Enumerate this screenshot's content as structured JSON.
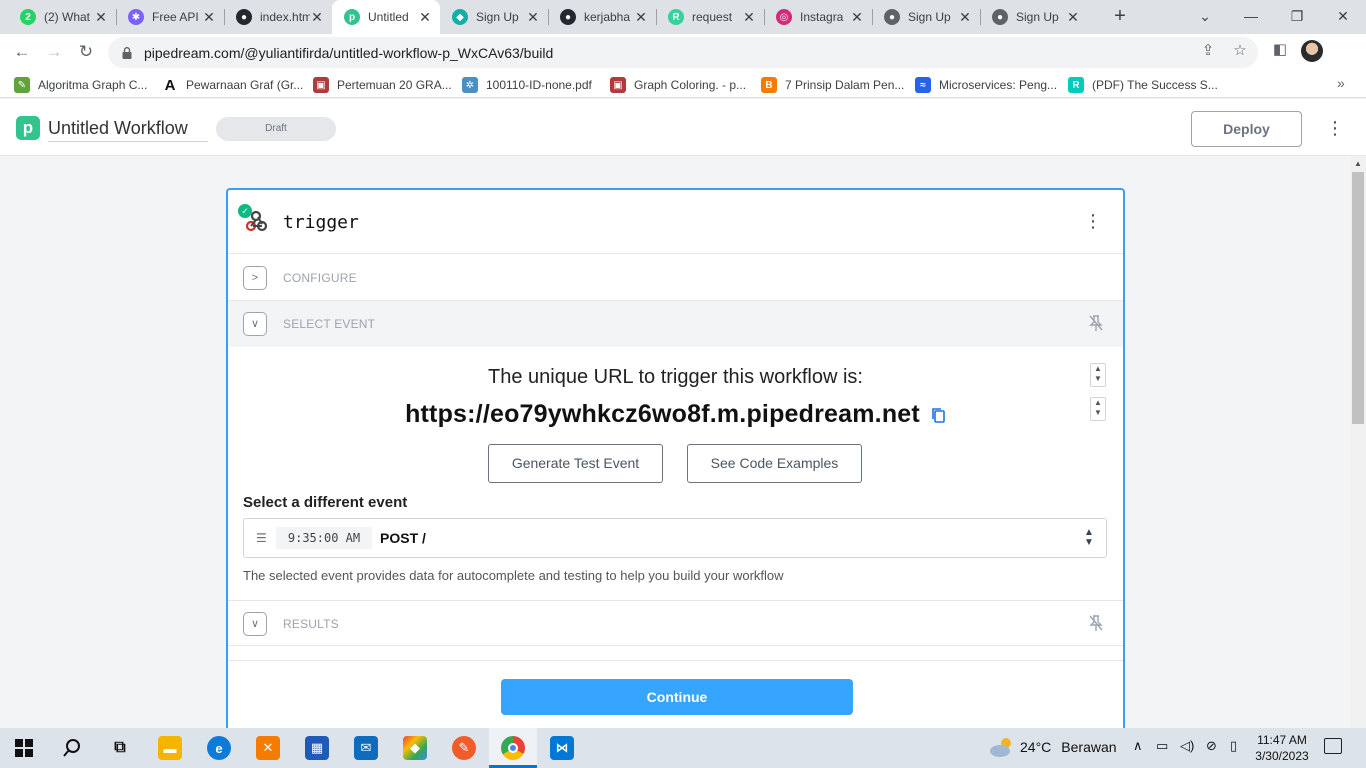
{
  "browser": {
    "tabs": [
      {
        "title": "(2) What",
        "favicon": "whatsapp-icon",
        "color": "#25d366",
        "glyph": "2"
      },
      {
        "title": "Free API",
        "favicon": "api-icon",
        "color": "#7b61ff",
        "glyph": "✱"
      },
      {
        "title": "index.htm",
        "favicon": "github-icon",
        "color": "#24292f",
        "glyph": "●"
      },
      {
        "title": "Untitled",
        "favicon": "pipedream-icon",
        "color": "#32c48d",
        "glyph": "p"
      },
      {
        "title": "Sign Up",
        "favicon": "leaf-icon",
        "color": "#10b0a8",
        "glyph": "◆"
      },
      {
        "title": "kerjabha",
        "favicon": "github-icon",
        "color": "#24292f",
        "glyph": "●"
      },
      {
        "title": "request",
        "favicon": "r-icon",
        "color": "#34d399",
        "glyph": "R"
      },
      {
        "title": "Instagra",
        "favicon": "instagram-icon",
        "color": "#d62976",
        "glyph": "◎"
      },
      {
        "title": "Sign Up",
        "favicon": "globe-icon",
        "color": "#5f6368",
        "glyph": "●"
      },
      {
        "title": "Sign Up",
        "favicon": "globe-icon",
        "color": "#5f6368",
        "glyph": "●"
      }
    ],
    "active_tab": 3,
    "url": "pipedream.com/@yuliantifirda/untitled-workflow-p_WxCAv63/build",
    "bookmarks": [
      {
        "label": "Algoritma Graph C...",
        "icon": "pen-icon",
        "color": "#5fa33a",
        "glyph": "✎"
      },
      {
        "label": "Pewarnaan Graf (Gr...",
        "icon": "letter-a-icon",
        "color": "#111111",
        "glyph": "A"
      },
      {
        "label": "Pertemuan 20 GRA...",
        "icon": "slides-icon",
        "color": "#b23a3a",
        "glyph": "▣"
      },
      {
        "label": "100110-ID-none.pdf",
        "icon": "network-icon",
        "color": "#4a90c2",
        "glyph": "✲"
      },
      {
        "label": "Graph Coloring. - p...",
        "icon": "slides-icon",
        "color": "#b23a3a",
        "glyph": "▣"
      },
      {
        "label": "7 Prinsip Dalam Pen...",
        "icon": "blogger-icon",
        "color": "#f57c00",
        "glyph": "B"
      },
      {
        "label": "Microservices: Peng...",
        "icon": "chart-icon",
        "color": "#2563eb",
        "glyph": "≈"
      },
      {
        "label": "(PDF) The Success S...",
        "icon": "researchgate-icon",
        "color": "#00ccbb",
        "glyph": "R"
      }
    ]
  },
  "header": {
    "title": "Untitled Workflow",
    "status": "Draft",
    "deploy_label": "Deploy"
  },
  "trigger": {
    "title": "trigger",
    "sections": {
      "configure": "CONFIGURE",
      "select_event": "SELECT EVENT",
      "results": "RESULTS"
    },
    "url_intro": "The unique URL to trigger this workflow is:",
    "url": "https://eo79ywhkcz6wo8f.m.pipedream.net",
    "generate_label": "Generate Test Event",
    "examples_label": "See Code Examples",
    "select_label": "Select a different event",
    "event_time": "9:35:00 AM",
    "event_method": "POST /",
    "hint": "The selected event provides data for autocomplete and testing to help you build your workflow",
    "continue_label": "Continue"
  },
  "taskbar": {
    "weather_temp": "24°C",
    "weather_desc": "Berawan",
    "time": "11:47 AM",
    "date": "3/30/2023"
  },
  "colors": {
    "accent": "#3b9ef5",
    "continue": "#35a5ff",
    "pipedream_green": "#32c48d",
    "success": "#10b981"
  }
}
